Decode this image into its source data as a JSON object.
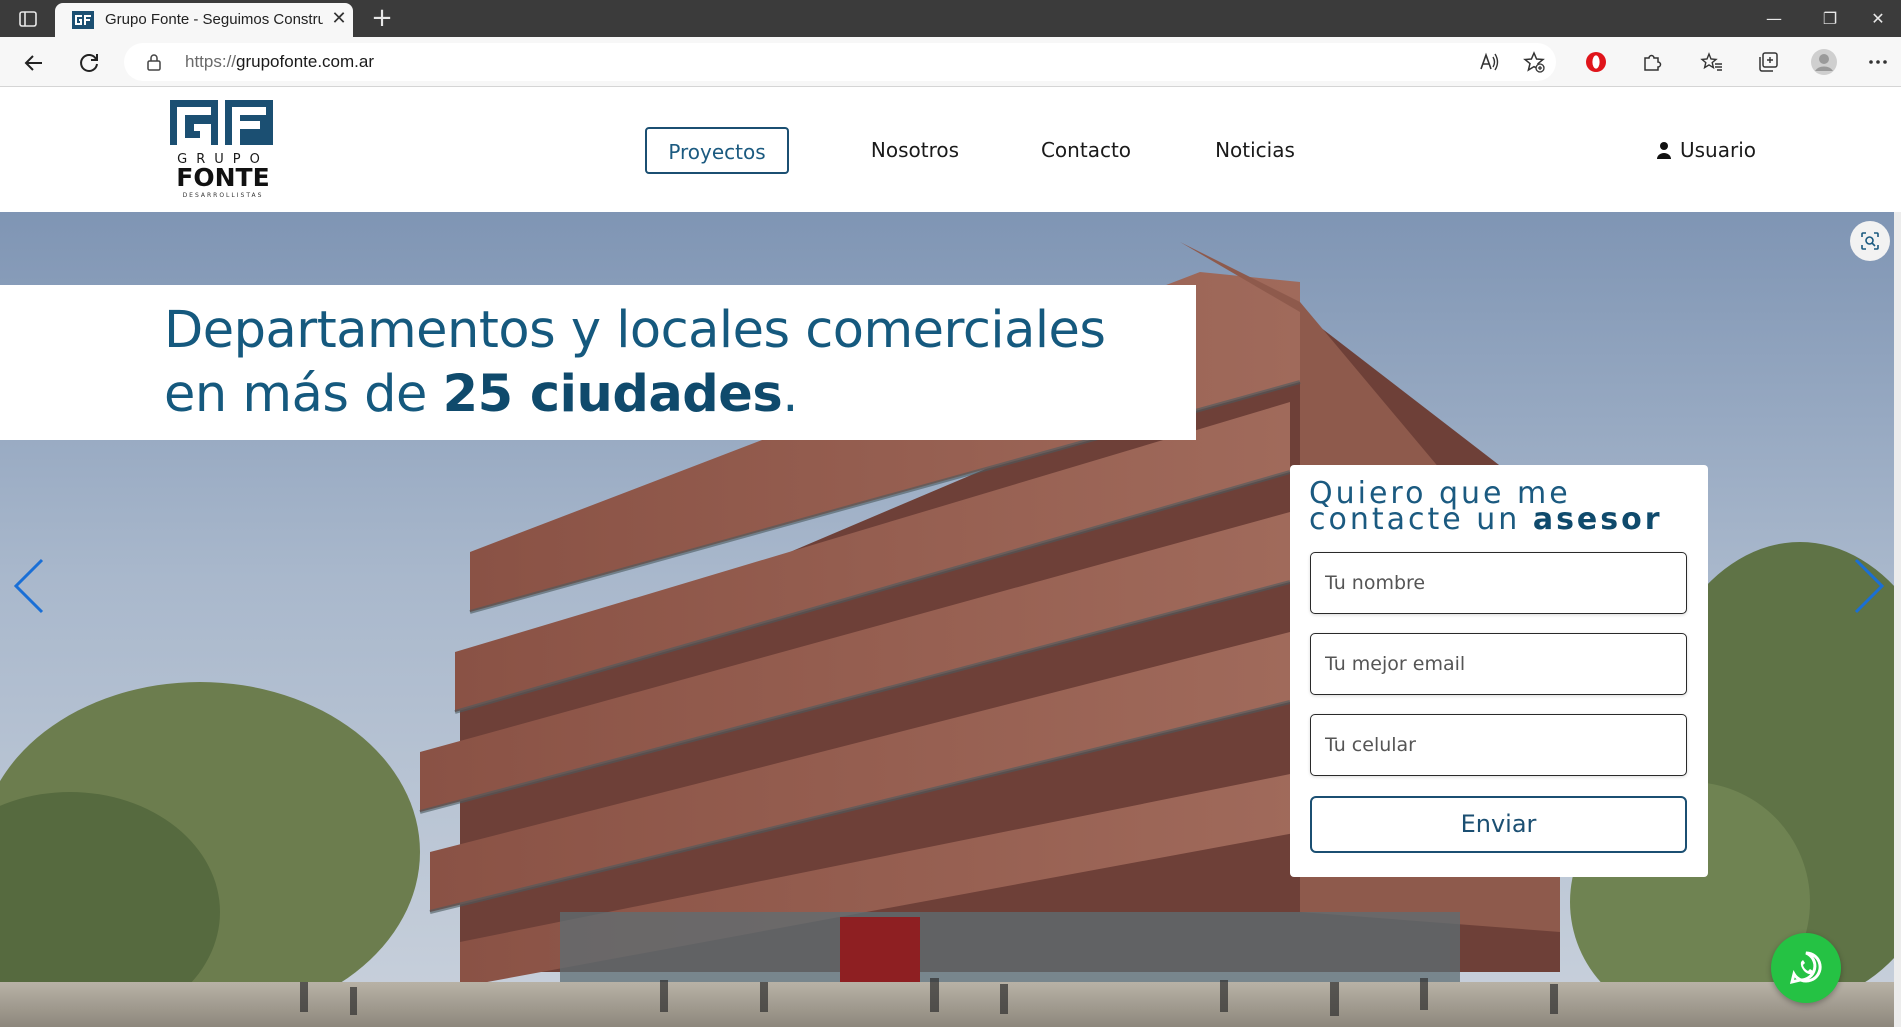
{
  "browser": {
    "tab_title": "Grupo Fonte - Seguimos Constru",
    "url_protocol": "https://",
    "url_host": "grupofonte.com.ar",
    "new_tab_symbol": "+",
    "close_symbol": "✕"
  },
  "site": {
    "logo_text": {
      "monogram": "GF",
      "grupo": "GRUPO",
      "fonte": "FONTE",
      "tagline": "DESARROLLISTAS"
    },
    "nav": [
      {
        "label": "Proyectos",
        "active": true
      },
      {
        "label": "Nosotros",
        "active": false
      },
      {
        "label": "Contacto",
        "active": false
      },
      {
        "label": "Noticias",
        "active": false
      }
    ],
    "user_label": "Usuario"
  },
  "hero": {
    "headline_line1": "Departamentos y locales comerciales",
    "headline_line2_pre": "en más de ",
    "headline_line2_bold": "25 ciudades",
    "headline_line2_post": "."
  },
  "contact_form": {
    "title_line1": "Quiero que me",
    "title_line2_pre": "contacte un ",
    "title_line2_bold": "asesor",
    "name_placeholder": "Tu nombre",
    "email_placeholder": "Tu mejor email",
    "phone_placeholder": "Tu celular",
    "submit_label": "Enviar"
  },
  "colors": {
    "brand_blue": "#15597e",
    "whatsapp_green": "#25c244"
  }
}
